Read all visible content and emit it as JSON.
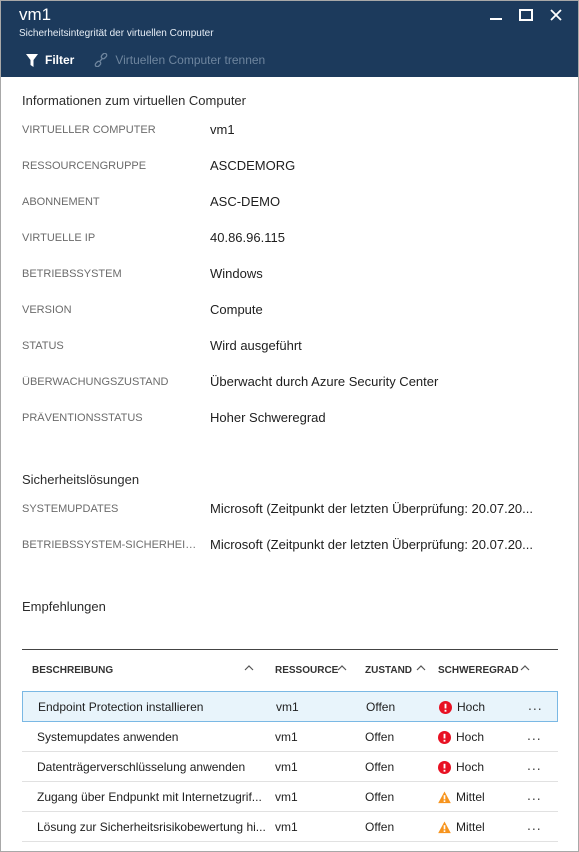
{
  "window": {
    "title": "vm1",
    "subtitle": "Sicherheitsintegrität der virtuellen Computer"
  },
  "toolbar": {
    "filter_label": "Filter",
    "disconnect_label": "Virtuellen Computer trennen"
  },
  "vm_info": {
    "title": "Informationen zum virtuellen Computer",
    "properties": [
      {
        "key": "VIRTUELLER COMPUTER",
        "value": "vm1"
      },
      {
        "key": "RESSOURCENGRUPPE",
        "value": "ASCDEMORG"
      },
      {
        "key": "ABONNEMENT",
        "value": "ASC-DEMO"
      },
      {
        "key": "VIRTUELLE IP",
        "value": "40.86.96.115"
      },
      {
        "key": "BETRIEBSSYSTEM",
        "value": "Windows"
      },
      {
        "key": "VERSION",
        "value": "Compute"
      },
      {
        "key": "STATUS",
        "value": "Wird ausgeführt"
      },
      {
        "key": "ÜBERWACHUNGSZUSTAND",
        "value": "Überwacht durch Azure Security Center"
      },
      {
        "key": "PRÄVENTIONSSTATUS",
        "value": "Hoher Schweregrad"
      }
    ]
  },
  "security_solutions": {
    "title": "Sicherheitslösungen",
    "properties": [
      {
        "key": "SYSTEMUPDATES",
        "value": "Microsoft (Zeitpunkt der letzten Überprüfung: 20.07.20..."
      },
      {
        "key": "BETRIEBSSYSTEM-SICHERHEITS...",
        "value": "Microsoft (Zeitpunkt der letzten Überprüfung: 20.07.20..."
      }
    ]
  },
  "recommendations": {
    "title": "Empfehlungen",
    "columns": {
      "description": "BESCHREIBUNG",
      "resource": "RESSOURCE",
      "state": "ZUSTAND",
      "severity": "SCHWEREGRAD"
    },
    "rows": [
      {
        "description": "Endpoint Protection installieren",
        "resource": "vm1",
        "state": "Offen",
        "severity": "Hoch",
        "severity_level": "high",
        "more": "..."
      },
      {
        "description": "Systemupdates anwenden",
        "resource": "vm1",
        "state": "Offen",
        "severity": "Hoch",
        "severity_level": "high",
        "more": "..."
      },
      {
        "description": "Datenträgerverschlüsselung anwenden",
        "resource": "vm1",
        "state": "Offen",
        "severity": "Hoch",
        "severity_level": "high",
        "more": "..."
      },
      {
        "description": "Zugang über Endpunkt mit Internetzugrif...",
        "resource": "vm1",
        "state": "Offen",
        "severity": "Mittel",
        "severity_level": "medium",
        "more": "..."
      },
      {
        "description": "Lösung zur Sicherheitsrisikobewertung hi...",
        "resource": "vm1",
        "state": "Offen",
        "severity": "Mittel",
        "severity_level": "medium",
        "more": "..."
      }
    ]
  },
  "colors": {
    "header_bg": "#1c3a5c",
    "high": "#e81123",
    "medium": "#f7941d",
    "selection": "#e8f4fb"
  }
}
